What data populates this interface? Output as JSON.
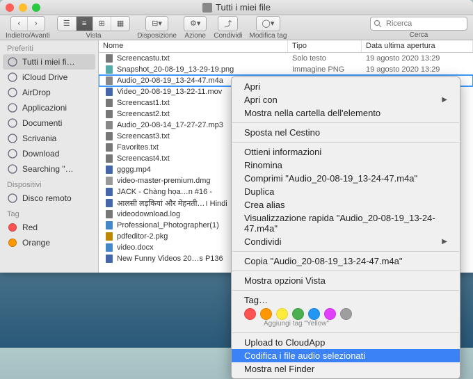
{
  "window": {
    "title": "Tutti i miei file"
  },
  "toolbar": {
    "back_forward": "Indietro/Avanti",
    "view": "Vista",
    "arrange": "Disposizione",
    "action": "Azione",
    "share": "Condividi",
    "edit_tags": "Modifica tag",
    "search_placeholder": "Ricerca",
    "search_label": "Cerca"
  },
  "sidebar": {
    "favorites": "Preferiti",
    "items": [
      {
        "label": "Tutti i miei fi…",
        "icon": "all-files",
        "selected": true
      },
      {
        "label": "iCloud Drive",
        "icon": "cloud"
      },
      {
        "label": "AirDrop",
        "icon": "airdrop"
      },
      {
        "label": "Applicazioni",
        "icon": "apps"
      },
      {
        "label": "Documenti",
        "icon": "documents"
      },
      {
        "label": "Scrivania",
        "icon": "desktop"
      },
      {
        "label": "Download",
        "icon": "download"
      },
      {
        "label": "Searching \"…",
        "icon": "search"
      }
    ],
    "devices": "Dispositivi",
    "device_items": [
      {
        "label": "Disco remoto",
        "icon": "remote-disc"
      }
    ],
    "tag": "Tag",
    "tags": [
      {
        "label": "Red",
        "color": "#ff5252"
      },
      {
        "label": "Orange",
        "color": "#ff9800"
      }
    ]
  },
  "columns": {
    "name": "Nome",
    "type": "Tipo",
    "date": "Data ultima apertura"
  },
  "files": [
    {
      "name": "Screencastu.txt",
      "type": "Solo testo",
      "date": "19 agosto 2020 13:29",
      "icon": "txt"
    },
    {
      "name": "Snapshot_20-08-19_13-29-19.png",
      "type": "Immagine PNG",
      "date": "19 agosto 2020 13:29",
      "icon": "img"
    },
    {
      "name": "Audio_20-08-19_13-24-47.m4a",
      "type": "",
      "date": "",
      "icon": "audio",
      "selected": true
    },
    {
      "name": "Video_20-08-19_13-22-11.mov",
      "type": "",
      "date": "",
      "icon": "video"
    },
    {
      "name": "Screencast1.txt",
      "type": "",
      "date": "",
      "icon": "txt"
    },
    {
      "name": "Screencast2.txt",
      "type": "",
      "date": "",
      "icon": "txt"
    },
    {
      "name": "Audio_20-08-14_17-27-27.mp3",
      "type": "",
      "date": "",
      "icon": "audio"
    },
    {
      "name": "Screencast3.txt",
      "type": "",
      "date": "",
      "icon": "txt"
    },
    {
      "name": "Favorites.txt",
      "type": "",
      "date": "",
      "icon": "txt"
    },
    {
      "name": "Screencast4.txt",
      "type": "",
      "date": "",
      "icon": "txt"
    },
    {
      "name": "gggg.mp4",
      "type": "",
      "date": "",
      "icon": "video"
    },
    {
      "name": "video-master-premium.dmg",
      "type": "",
      "date": "",
      "icon": "dmg"
    },
    {
      "name": "JACK - Chàng họa…n #16 -",
      "type": "",
      "date": "",
      "icon": "video"
    },
    {
      "name": "आलसी लड़कियां और मेहनती…। Hindi",
      "type": "",
      "date": "",
      "icon": "video"
    },
    {
      "name": "videodownload.log",
      "type": "",
      "date": "",
      "icon": "txt"
    },
    {
      "name": "Professional_Photographer(1)",
      "type": "",
      "date": "",
      "icon": "doc"
    },
    {
      "name": "pdfeditor-2.pkg",
      "type": "",
      "date": "",
      "icon": "pkg"
    },
    {
      "name": "video.docx",
      "type": "",
      "date": "",
      "icon": "doc"
    },
    {
      "name": "New Funny Videos 20…s P136",
      "type": "",
      "date": "",
      "icon": "video"
    }
  ],
  "context_menu": {
    "open": "Apri",
    "open_with": "Apri con",
    "show_in_folder": "Mostra nella cartella dell'elemento",
    "move_to_trash": "Sposta nel Cestino",
    "get_info": "Ottieni informazioni",
    "rename": "Rinomina",
    "compress": "Comprimi \"Audio_20-08-19_13-24-47.m4a\"",
    "duplicate": "Duplica",
    "make_alias": "Crea alias",
    "quick_look": "Visualizzazione rapida \"Audio_20-08-19_13-24-47.m4a\"",
    "share": "Condividi",
    "copy": "Copia \"Audio_20-08-19_13-24-47.m4a\"",
    "view_options": "Mostra opzioni Vista",
    "tag": "Tag…",
    "tag_hint": "Aggiungi tag \"Yellow\"",
    "tag_colors": [
      "#ff5252",
      "#ff9800",
      "#ffeb3b",
      "#4caf50",
      "#2196f3",
      "#e040fb",
      "#9e9e9e"
    ],
    "upload_cloudapp": "Upload to CloudApp",
    "encode_audio": "Codifica i file audio selezionati",
    "show_in_finder": "Mostra nel Finder"
  }
}
